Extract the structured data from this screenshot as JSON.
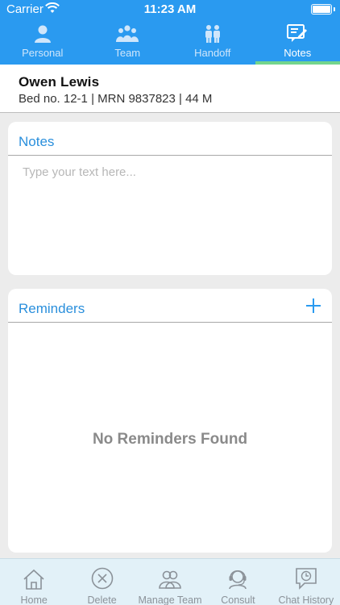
{
  "status_bar": {
    "carrier": "Carrier",
    "time": "11:23 AM"
  },
  "top_tabs": [
    {
      "label": "Personal",
      "icon": "person-icon",
      "active": false
    },
    {
      "label": "Team",
      "icon": "team-icon",
      "active": false
    },
    {
      "label": "Handoff",
      "icon": "handoff-icon",
      "active": false
    },
    {
      "label": "Notes",
      "icon": "notes-icon",
      "active": true
    }
  ],
  "patient": {
    "name": "Owen Lewis",
    "info": "Bed no. 12-1 | MRN 9837823 | 44 M"
  },
  "notes": {
    "title": "Notes",
    "value": "",
    "placeholder": "Type your text here..."
  },
  "reminders": {
    "title": "Reminders",
    "empty_text": "No Reminders Found"
  },
  "bottom_tabs": [
    {
      "label": "Home",
      "icon": "home-icon"
    },
    {
      "label": "Delete",
      "icon": "delete-icon"
    },
    {
      "label": "Manage Team",
      "icon": "manage-team-icon"
    },
    {
      "label": "Consult",
      "icon": "consult-icon"
    },
    {
      "label": "Chat History",
      "icon": "chat-history-icon"
    }
  ],
  "colors": {
    "header_blue": "#2a9af0",
    "active_tab_indicator": "#73d58c",
    "accent_text": "#2a8fdc",
    "bottom_bar": "#e2f1f8"
  }
}
